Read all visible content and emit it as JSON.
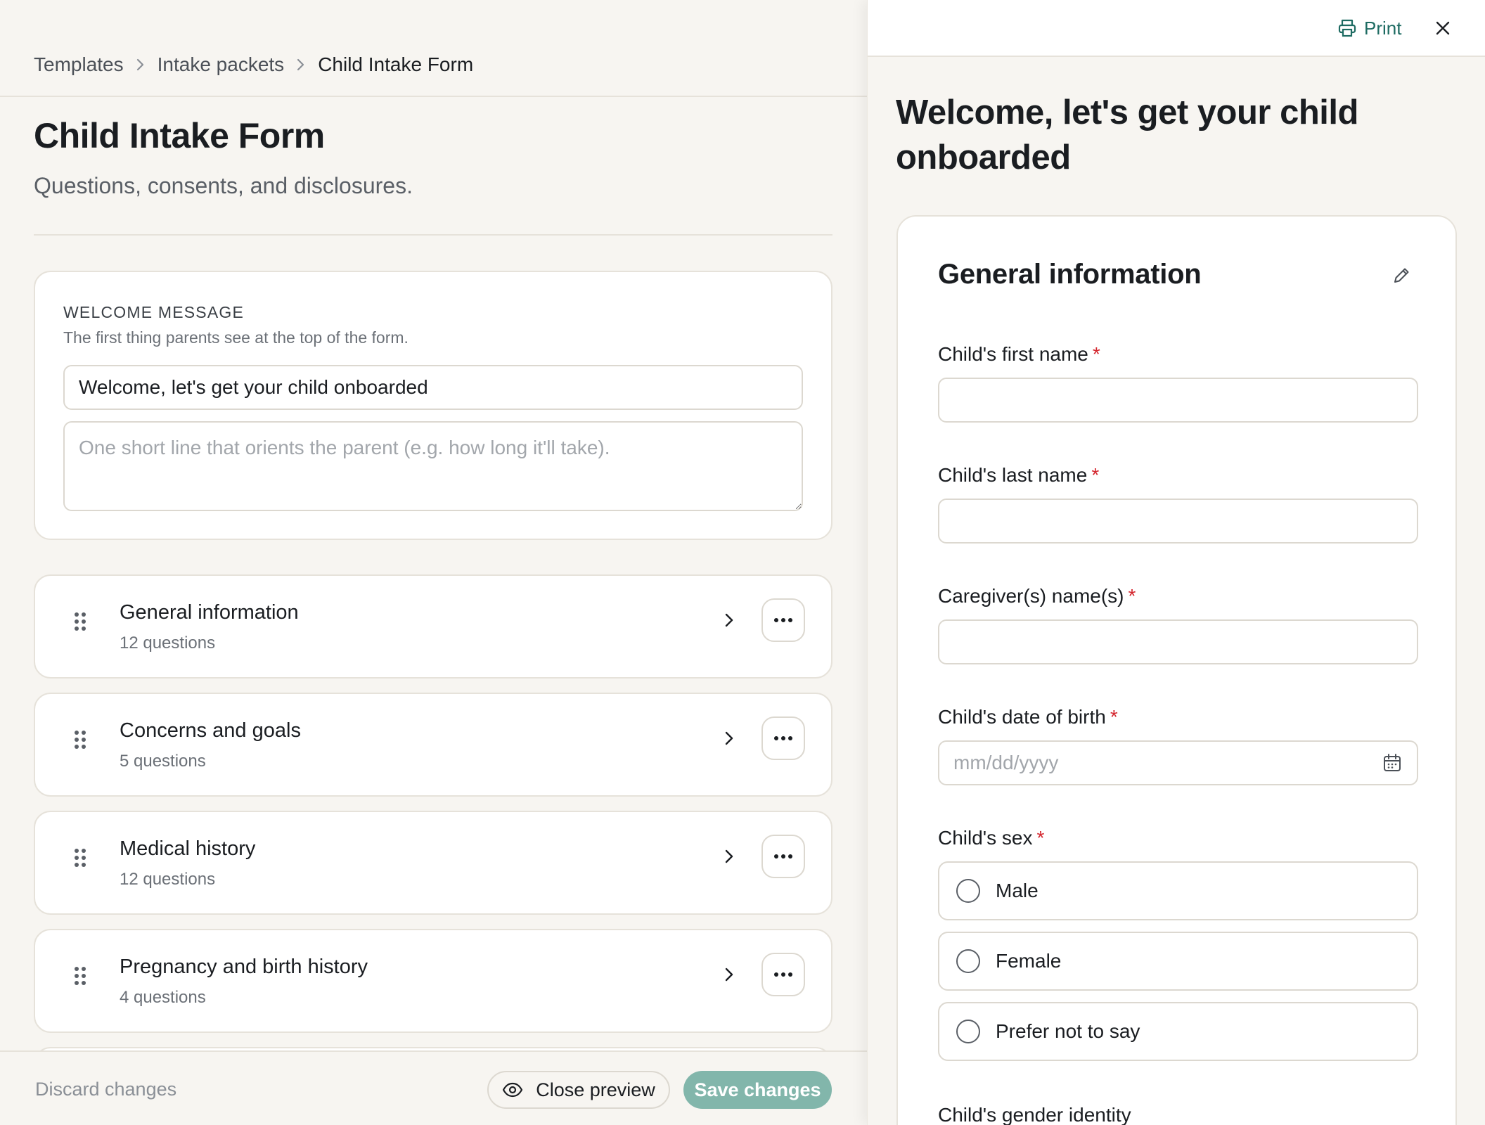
{
  "breadcrumb": {
    "items": [
      "Templates",
      "Intake packets",
      "Child Intake Form"
    ]
  },
  "page": {
    "title": "Child Intake Form",
    "subtitle": "Questions, consents, and disclosures."
  },
  "welcome": {
    "heading": "WELCOME MESSAGE",
    "help": "The first thing parents see at the top of the form.",
    "title_value": "Welcome, let's get your child onboarded",
    "subtext_placeholder": "One short line that orients the parent (e.g. how long it'll take)."
  },
  "sections": [
    {
      "title": "General information",
      "count": "12 questions"
    },
    {
      "title": "Concerns and goals",
      "count": "5 questions"
    },
    {
      "title": "Medical history",
      "count": "12 questions"
    },
    {
      "title": "Pregnancy and birth history",
      "count": "4 questions"
    }
  ],
  "footer": {
    "discard_label": "Discard changes",
    "close_preview_label": "Close preview",
    "save_label": "Save changes"
  },
  "preview": {
    "print_label": "Print",
    "title": "Welcome, let's get your child onboarded",
    "section_title": "General information",
    "fields": {
      "first_name": "Child's first name",
      "last_name": "Child's last name",
      "caregiver": "Caregiver(s) name(s)",
      "dob": "Child's date of birth",
      "dob_placeholder": "mm/dd/yyyy",
      "sex": "Child's sex",
      "gender": "Child's gender identity"
    },
    "required_mark": "*",
    "sex_options": [
      "Male",
      "Female",
      "Prefer not to say"
    ]
  },
  "colors": {
    "accent": "#1d6b62",
    "save_button": "#82b6ab",
    "required": "#d4262e",
    "background": "#f7f5f1"
  },
  "icons": [
    "chevron-right-icon",
    "drag-handle-icon",
    "more-horizontal-icon",
    "eye-icon",
    "printer-icon",
    "close-icon",
    "pencil-icon",
    "calendar-icon"
  ]
}
